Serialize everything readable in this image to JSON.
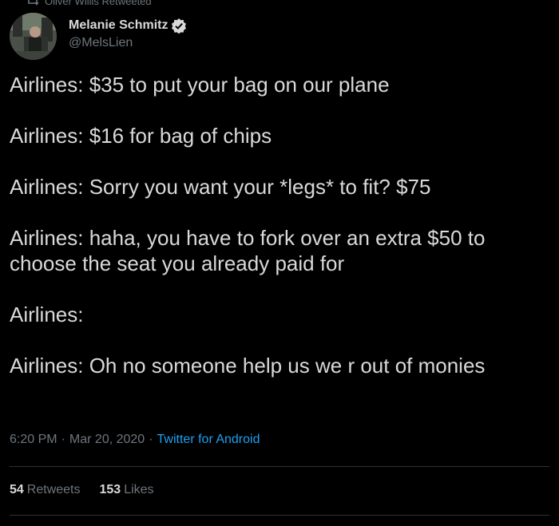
{
  "retweet_context": {
    "text": "Oliver Willis Retweeted",
    "icon": "retweet-icon"
  },
  "author": {
    "name": "Melanie Schmitz",
    "handle": "@MelsLien",
    "verified": true,
    "verified_icon": "verified-badge-icon"
  },
  "tweet": {
    "lines": [
      "Airlines: $35 to put your bag on our plane",
      "",
      "Airlines: $16 for bag of chips",
      "",
      "Airlines: Sorry you want your *legs* to fit? $75",
      "",
      "Airlines: haha, you have to fork over an extra $50 to",
      "choose the seat you already paid for",
      "",
      "Airlines:",
      "",
      "Airlines: Oh no someone help us we r out of monies"
    ]
  },
  "meta": {
    "time": "6:20 PM",
    "separator": "·",
    "date": "Mar 20, 2020",
    "source": "Twitter for Android"
  },
  "stats": {
    "retweets_count": "54",
    "retweets_label": "Retweets",
    "likes_count": "153",
    "likes_label": "Likes"
  },
  "colors": {
    "background": "#000000",
    "text": "#d9d9d9",
    "secondary": "#6e767d",
    "link": "#1da1f2",
    "divider": "#2f3336"
  }
}
